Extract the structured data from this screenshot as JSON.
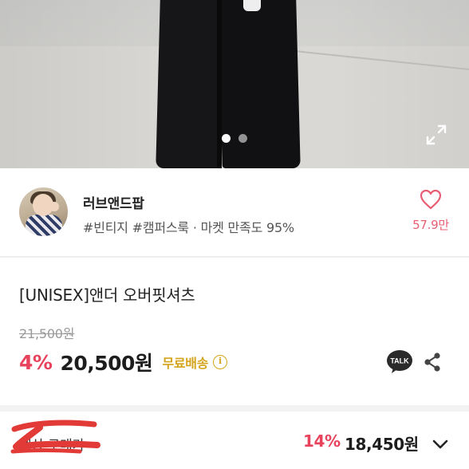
{
  "gallery": {
    "image_alt": "product photo",
    "slide_count": 2,
    "active_slide": 1,
    "expand_icon": "expand-icon"
  },
  "shop": {
    "name": "러브앤드팝",
    "meta": "#빈티지 #캠퍼스룩 · 마켓 만족도 95%",
    "like_icon": "heart-outline-icon",
    "like_count": "57.9만"
  },
  "product": {
    "title": "[UNISEX]앤더 오버핏셔츠",
    "original_price": "21,500원",
    "discount": "4%",
    "price": "20,500원",
    "shipping": "무료배송",
    "info_glyph": "i",
    "talk_label": "TALK",
    "share_icon": "share-icon"
  },
  "purchase_bar": {
    "label": "예상 구매가",
    "discount": "14%",
    "price": "18,450원",
    "toggle_icon": "chevron-down-icon"
  },
  "colors": {
    "accent_red": "#e8435d",
    "like_pink": "#e85e74",
    "shipping_gold": "#d4a41c",
    "redaction_red": "#e23a36"
  }
}
